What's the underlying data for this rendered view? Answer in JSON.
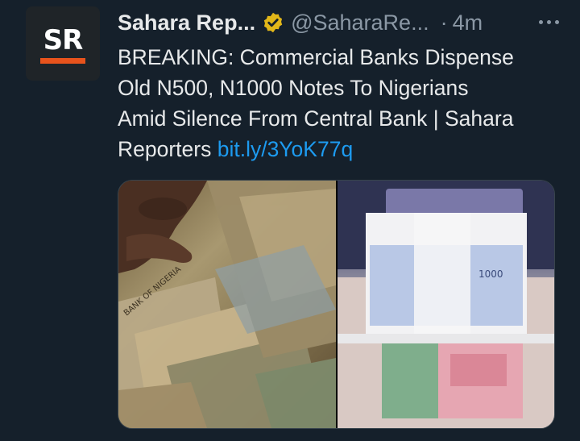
{
  "author": {
    "avatar_text": "SR",
    "display_name": "Sahara Rep...",
    "handle": "@SaharaRe...",
    "separator": "·",
    "timestamp": "4m",
    "verified": true
  },
  "tweet": {
    "text_lines": [
      "BREAKING: Commercial Banks Dispense",
      "Old N500, N1000 Notes To Nigerians",
      "Amid Silence From Central Bank | Sahara",
      "Reporters "
    ],
    "link": "bit.ly/3YoK77q"
  },
  "media": {
    "left_image": "photo-hand-holding-old-naira-notes",
    "right_image": "photo-stacks-of-new-naira-notes",
    "left_note_text": "BANK OF NIGERIA",
    "right_note_text": "1000"
  },
  "colors": {
    "background": "#15202b",
    "text": "#e7e9ea",
    "secondary": "#8b98a5",
    "link": "#1d9bf0",
    "verified_badge": "#e2b719",
    "brand_bar": "#e8531c"
  },
  "icons": {
    "verified": "verified-badge-icon",
    "more": "more-options-icon"
  }
}
